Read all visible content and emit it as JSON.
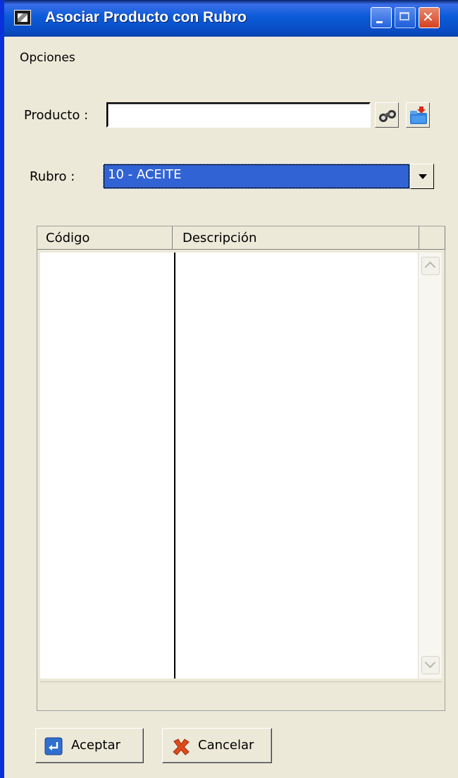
{
  "window": {
    "title": "Asociar Producto con Rubro"
  },
  "menu": {
    "opciones": "Opciones"
  },
  "form": {
    "producto_label": "Producto :",
    "producto_value": "",
    "rubro_label": "Rubro :",
    "rubro_selected": "10 - ACEITE"
  },
  "grid": {
    "columns": [
      "Código",
      "Descripción"
    ],
    "rows": []
  },
  "buttons": {
    "accept": "Aceptar",
    "cancel": "Cancelar"
  },
  "colors": {
    "title_bar": "#0a4ec6",
    "selection": "#3163d4",
    "window_bg": "#ece9d8"
  }
}
